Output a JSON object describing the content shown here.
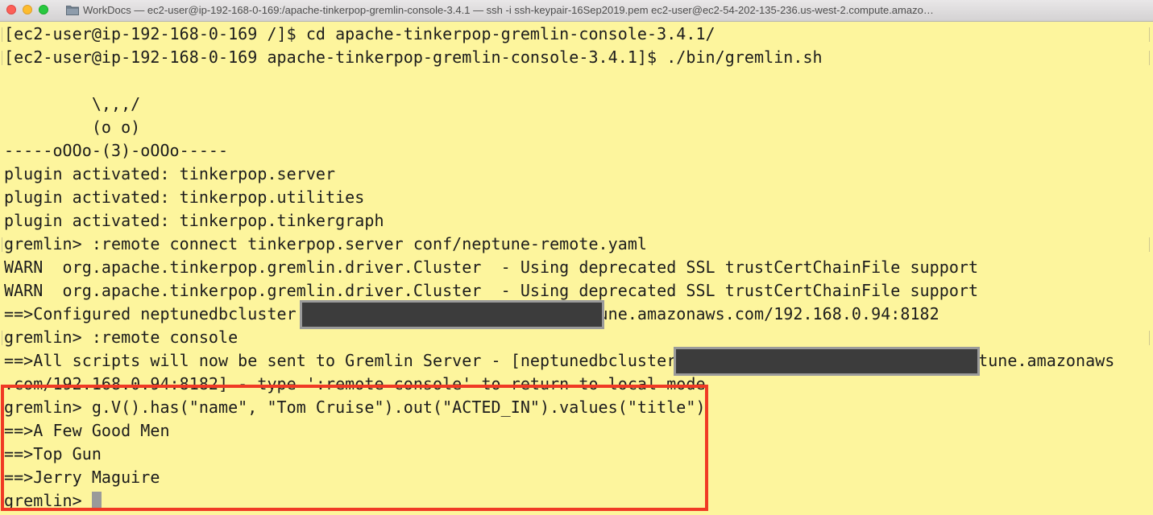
{
  "window": {
    "title": "WorkDocs — ec2-user@ip-192-168-0-169:/apache-tinkerpop-gremlin-console-3.4.1 — ssh -i ssh-keypair-16Sep2019.pem ec2-user@ec2-54-202-135-236.us-west-2.compute.amazo…",
    "folder_icon": "folder-icon"
  },
  "terminal": {
    "background": "#fdf59d",
    "highlight_color": "#f03a24",
    "lines": [
      "[ec2-user@ip-192-168-0-169 /]$ cd apache-tinkerpop-gremlin-console-3.4.1/",
      "[ec2-user@ip-192-168-0-169 apache-tinkerpop-gremlin-console-3.4.1]$ ./bin/gremlin.sh",
      "",
      "         \\,,,/",
      "         (o o)",
      "-----oOOo-(3)-oOOo-----",
      "plugin activated: tinkerpop.server",
      "plugin activated: tinkerpop.utilities",
      "plugin activated: tinkerpop.tinkergraph",
      "gremlin> :remote connect tinkerpop.server conf/neptune-remote.yaml",
      "WARN  org.apache.tinkerpop.gremlin.driver.Cluster  - Using deprecated SSL trustCertChainFile support",
      "WARN  org.apache.tinkerpop.gremlin.driver.Cluster  - Using deprecated SSL trustCertChainFile support",
      "==>Configured neptunedbcluster.                          neptune.amazonaws.com/192.168.0.94:8182",
      "gremlin> :remote console",
      "==>All scripts will now be sent to Gremlin Server - [neptunedbcluster.                          .neptune.amazonaws",
      ".com/192.168.0.94:8182] - type ':remote console' to return to local mode",
      "gremlin> g.V().has(\"name\", \"Tom Cruise\").out(\"ACTED_IN\").values(\"title\")",
      "==>A Few Good Men",
      "==>Top Gun",
      "==>Jerry Maguire",
      "gremlin> "
    ]
  }
}
